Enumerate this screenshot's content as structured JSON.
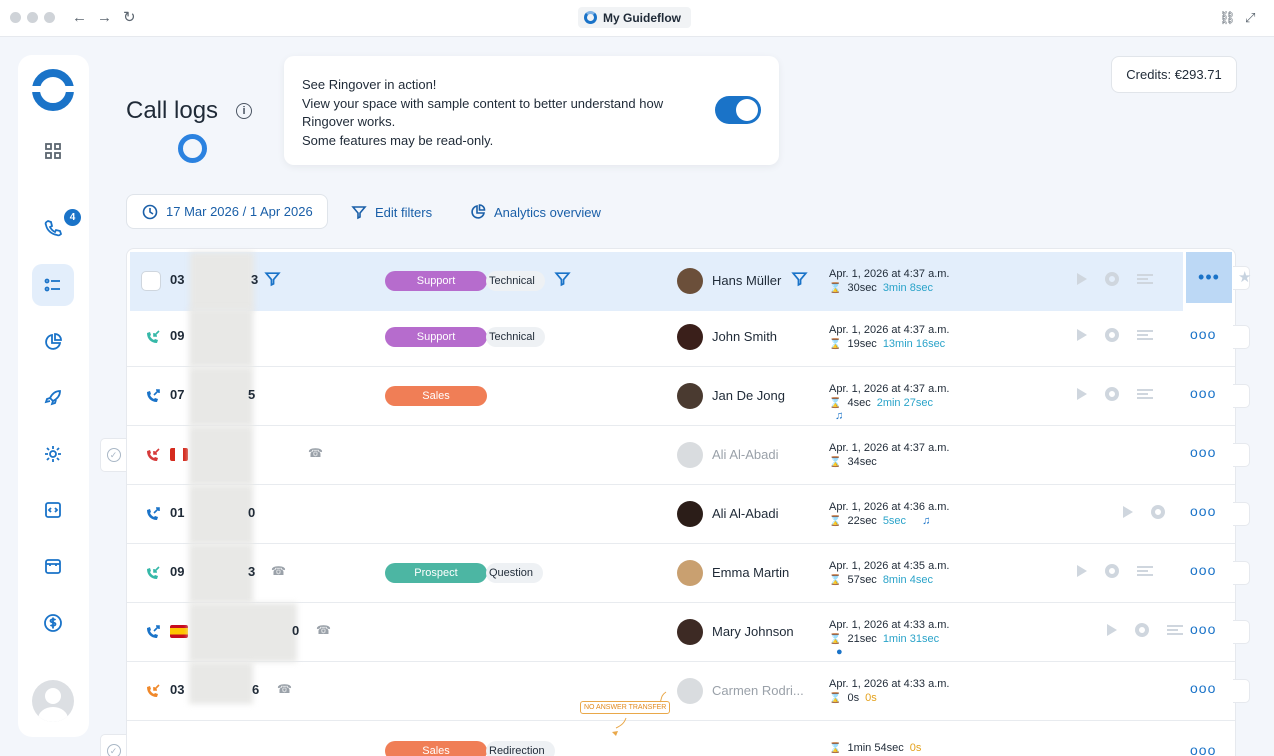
{
  "browser": {
    "tab_title": "My Guideflow"
  },
  "sidebar": {
    "call_badge": "4"
  },
  "header": {
    "title": "Call logs",
    "info": "i"
  },
  "promo": {
    "line1": "See Ringover in action!",
    "line2": "View your space with sample content to better understand how",
    "line3": "Ringover works.",
    "line4": "Some features may be read-only.",
    "toggle_on": true
  },
  "credits": {
    "label": "Credits: €293.71"
  },
  "filters": {
    "date_range": "17 Mar 2026 / 1 Apr 2026",
    "edit_filters": "Edit filters",
    "analytics": "Analytics overview"
  },
  "rows": [
    {
      "num_prefix": "03",
      "num_suffix": "3",
      "tag1": "Support",
      "tag2": "Technical",
      "contact": "Hans Müller",
      "datetime": "Apr. 1, 2026 at 4:37 a.m.",
      "ring": "30sec",
      "talk": "3min 8sec"
    },
    {
      "num_prefix": "09",
      "num_suffix": "",
      "tag1": "Support",
      "tag2": "Technical",
      "contact": "John Smith",
      "datetime": "Apr. 1, 2026 at 4:37 a.m.",
      "ring": "19sec",
      "talk": "13min 16sec"
    },
    {
      "num_prefix": "07",
      "num_suffix": "5",
      "tag1": "Sales",
      "tag2": "",
      "contact": "Jan De Jong",
      "datetime": "Apr. 1, 2026 at 4:37 a.m.",
      "ring": "4sec",
      "talk": "2min 27sec",
      "note": "♫"
    },
    {
      "num_prefix": "",
      "num_suffix": "",
      "tag1": "",
      "tag2": "",
      "contact": "Ali Al-Abadi",
      "datetime": "Apr. 1, 2026 at 4:37 a.m.",
      "ring": "34sec",
      "talk": ""
    },
    {
      "num_prefix": "01",
      "num_suffix": "0",
      "tag1": "",
      "tag2": "",
      "contact": "Ali Al-Abadi",
      "datetime": "Apr. 1, 2026 at 4:36 a.m.",
      "ring": "22sec",
      "talk": "5sec",
      "note": "♫"
    },
    {
      "num_prefix": "09",
      "num_suffix": "3",
      "tag1": "Prospect",
      "tag2": "Question",
      "contact": "Emma Martin",
      "datetime": "Apr. 1, 2026 at 4:35 a.m.",
      "ring": "57sec",
      "talk": "8min 4sec"
    },
    {
      "num_prefix": "",
      "num_suffix": "0",
      "tag1": "",
      "tag2": "",
      "contact": "Mary Johnson",
      "datetime": "Apr. 1, 2026 at 4:33 a.m.",
      "ring": "21sec",
      "talk": "1min 31sec"
    },
    {
      "num_prefix": "03",
      "num_suffix": "6",
      "tag1": "",
      "tag2": "",
      "contact": "Carmen Rodri...",
      "datetime": "Apr. 1, 2026 at 4:33 a.m.",
      "ring": "0s",
      "talk": "0s"
    },
    {
      "num_prefix": "",
      "num_suffix": "",
      "tag1": "Sales",
      "tag2": "Redirection",
      "contact": "",
      "datetime": "",
      "ring": "1min 54sec",
      "talk": "0s"
    }
  ],
  "transfer_label": "NO ANSWER TRANSFER",
  "colors": {
    "accent": "#1a73c8",
    "support": "#b66ccd",
    "sales": "#f07e56",
    "prospect": "#4cb6a3"
  }
}
